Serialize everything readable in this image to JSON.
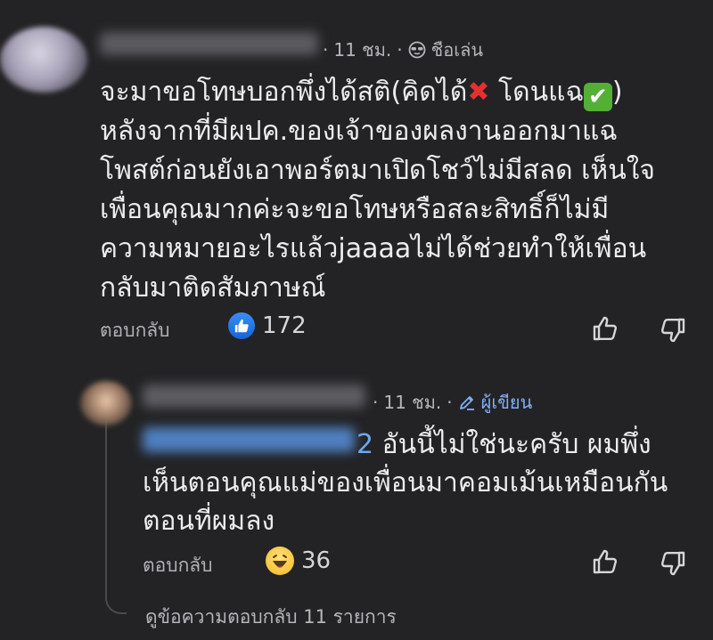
{
  "main_comment": {
    "time": "11 ชม.",
    "badge_label": "ชือเล่น",
    "text_lines": [
      "จะมาขอโทษบอกพึ่งได้สติ(คิดได้",
      "หลังจากที่มีผปค.ของเจ้าของผลงานออกมาแฉ",
      "โพสต์ก่อนยังเอาพอร์ตมาเปิดโชว์ไม่มีสลด เห็นใจ",
      "เพื่อนคุณมากค่ะจะขอโทษหรือสละสิทธิ์ก็ไม่มี",
      "ความหมายอะไรแล้วjaaaaไม่ได้ช่วยทำให้เพื่อน",
      "กลับมาติดสัมภาษณ์"
    ],
    "line1_mid": "โดนแฉ",
    "line1_end": ")",
    "reply_label": "ตอบกลับ",
    "reaction_count": "172"
  },
  "reply_comment": {
    "time": "11 ชม.",
    "author_label": "ผู้เขียน",
    "mention_tail": "2",
    "text_lines": [
      " อันนี้ไม่ใช่นะครับ ผมพึ่ง",
      "เห็นตอนคุณแม่ของเพื่อนมาคอมเม้นเหมือนกัน",
      "ตอนที่ผมลง"
    ],
    "reply_label": "ตอบกลับ",
    "reaction_count": "36"
  },
  "view_more_replies": "ดูข้อความตอบกลับ 11 รายการ",
  "colors": {
    "background": "#232325",
    "link_blue": "#7fb0f5",
    "like_blue": "#1877f2"
  },
  "icons": [
    "sunglasses-icon",
    "pencil-icon",
    "like-reaction-icon",
    "haha-reaction-icon",
    "thumbs-up-icon",
    "thumbs-down-icon",
    "cross-mark-icon",
    "check-mark-icon"
  ]
}
